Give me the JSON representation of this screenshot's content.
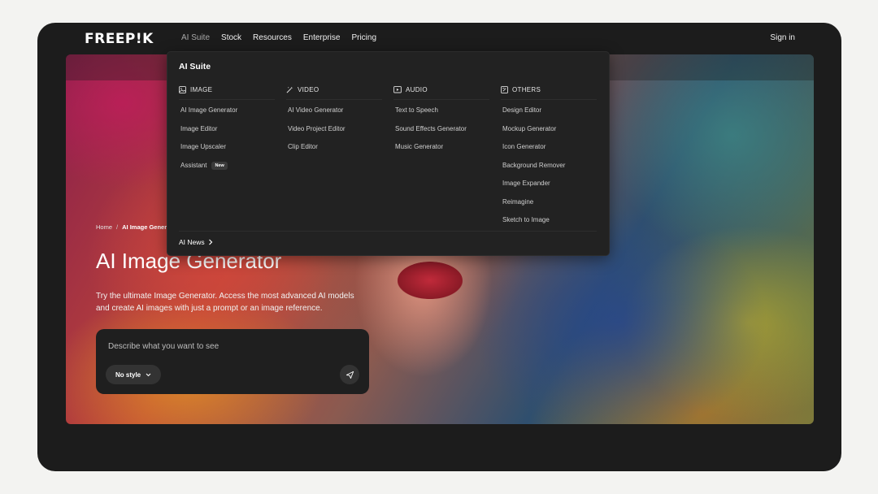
{
  "brand": {
    "logo_text": "FREEP!K"
  },
  "nav": {
    "items": [
      {
        "label": "AI Suite",
        "active": true
      },
      {
        "label": "Stock"
      },
      {
        "label": "Resources"
      },
      {
        "label": "Enterprise"
      },
      {
        "label": "Pricing"
      }
    ],
    "sign_in": "Sign in"
  },
  "dropdown": {
    "title": "AI Suite",
    "columns": [
      {
        "heading": "IMAGE",
        "icon": "image-icon",
        "items": [
          {
            "label": "AI Image Generator"
          },
          {
            "label": "Image Editor"
          },
          {
            "label": "Image Upscaler"
          },
          {
            "label": "Assistant",
            "badge": "New"
          }
        ]
      },
      {
        "heading": "VIDEO",
        "icon": "magic-wand-icon",
        "items": [
          {
            "label": "AI Video Generator"
          },
          {
            "label": "Video Project Editor"
          },
          {
            "label": "Clip Editor"
          }
        ]
      },
      {
        "heading": "AUDIO",
        "icon": "play-screen-icon",
        "items": [
          {
            "label": "Text to Speech"
          },
          {
            "label": "Sound Effects Generator"
          },
          {
            "label": "Music Generator"
          }
        ]
      },
      {
        "heading": "OTHERS",
        "icon": "design-tools-icon",
        "items": [
          {
            "label": "Design Editor"
          },
          {
            "label": "Mockup Generator"
          },
          {
            "label": "Icon Generator"
          },
          {
            "label": "Background Remover"
          },
          {
            "label": "Image Expander"
          },
          {
            "label": "Reimagine"
          },
          {
            "label": "Sketch to Image"
          }
        ]
      }
    ],
    "footer_link": "AI News"
  },
  "hero": {
    "breadcrumb": {
      "home": "Home",
      "separator": "/",
      "current": "AI Image Genera"
    },
    "title": "AI Image Generator",
    "description": "Try the ultimate Image Generator. Access the most advanced AI models and create AI images with just a prompt or an image reference."
  },
  "prompt": {
    "placeholder": "Describe what you want to see",
    "style_label": "No style"
  },
  "colors": {
    "frame_bg": "#1c1c1c",
    "dropdown_bg": "#222222",
    "page_bg": "#f3f3f1"
  }
}
